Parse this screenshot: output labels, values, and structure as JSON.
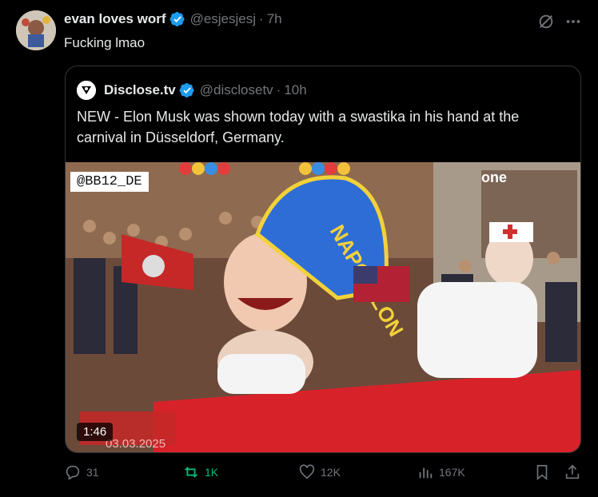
{
  "post": {
    "display_name": "evan loves worf",
    "handle": "@esjesjesj",
    "separator": "·",
    "time": "7h",
    "text": "Fucking lmao"
  },
  "quote": {
    "display_name": "Disclose.tv",
    "handle": "@disclosetv",
    "separator": "·",
    "time": "10h",
    "text": "NEW - Elon Musk was shown today with a swastika in his hand at the carnival in Düsseldorf, Germany.",
    "media": {
      "watermark": "@BB12_DE",
      "duration": "1:46",
      "banner_text": "03.03.2025",
      "float_text": "NAPO-ELON",
      "channel_logo": "one"
    }
  },
  "actions": {
    "replies": "31",
    "reposts": "1K",
    "likes": "12K",
    "views": "167K"
  },
  "colors": {
    "background": "#000000",
    "accent": "#1d9bf0",
    "repost_active": "#00ba7c",
    "muted": "#71767b"
  }
}
